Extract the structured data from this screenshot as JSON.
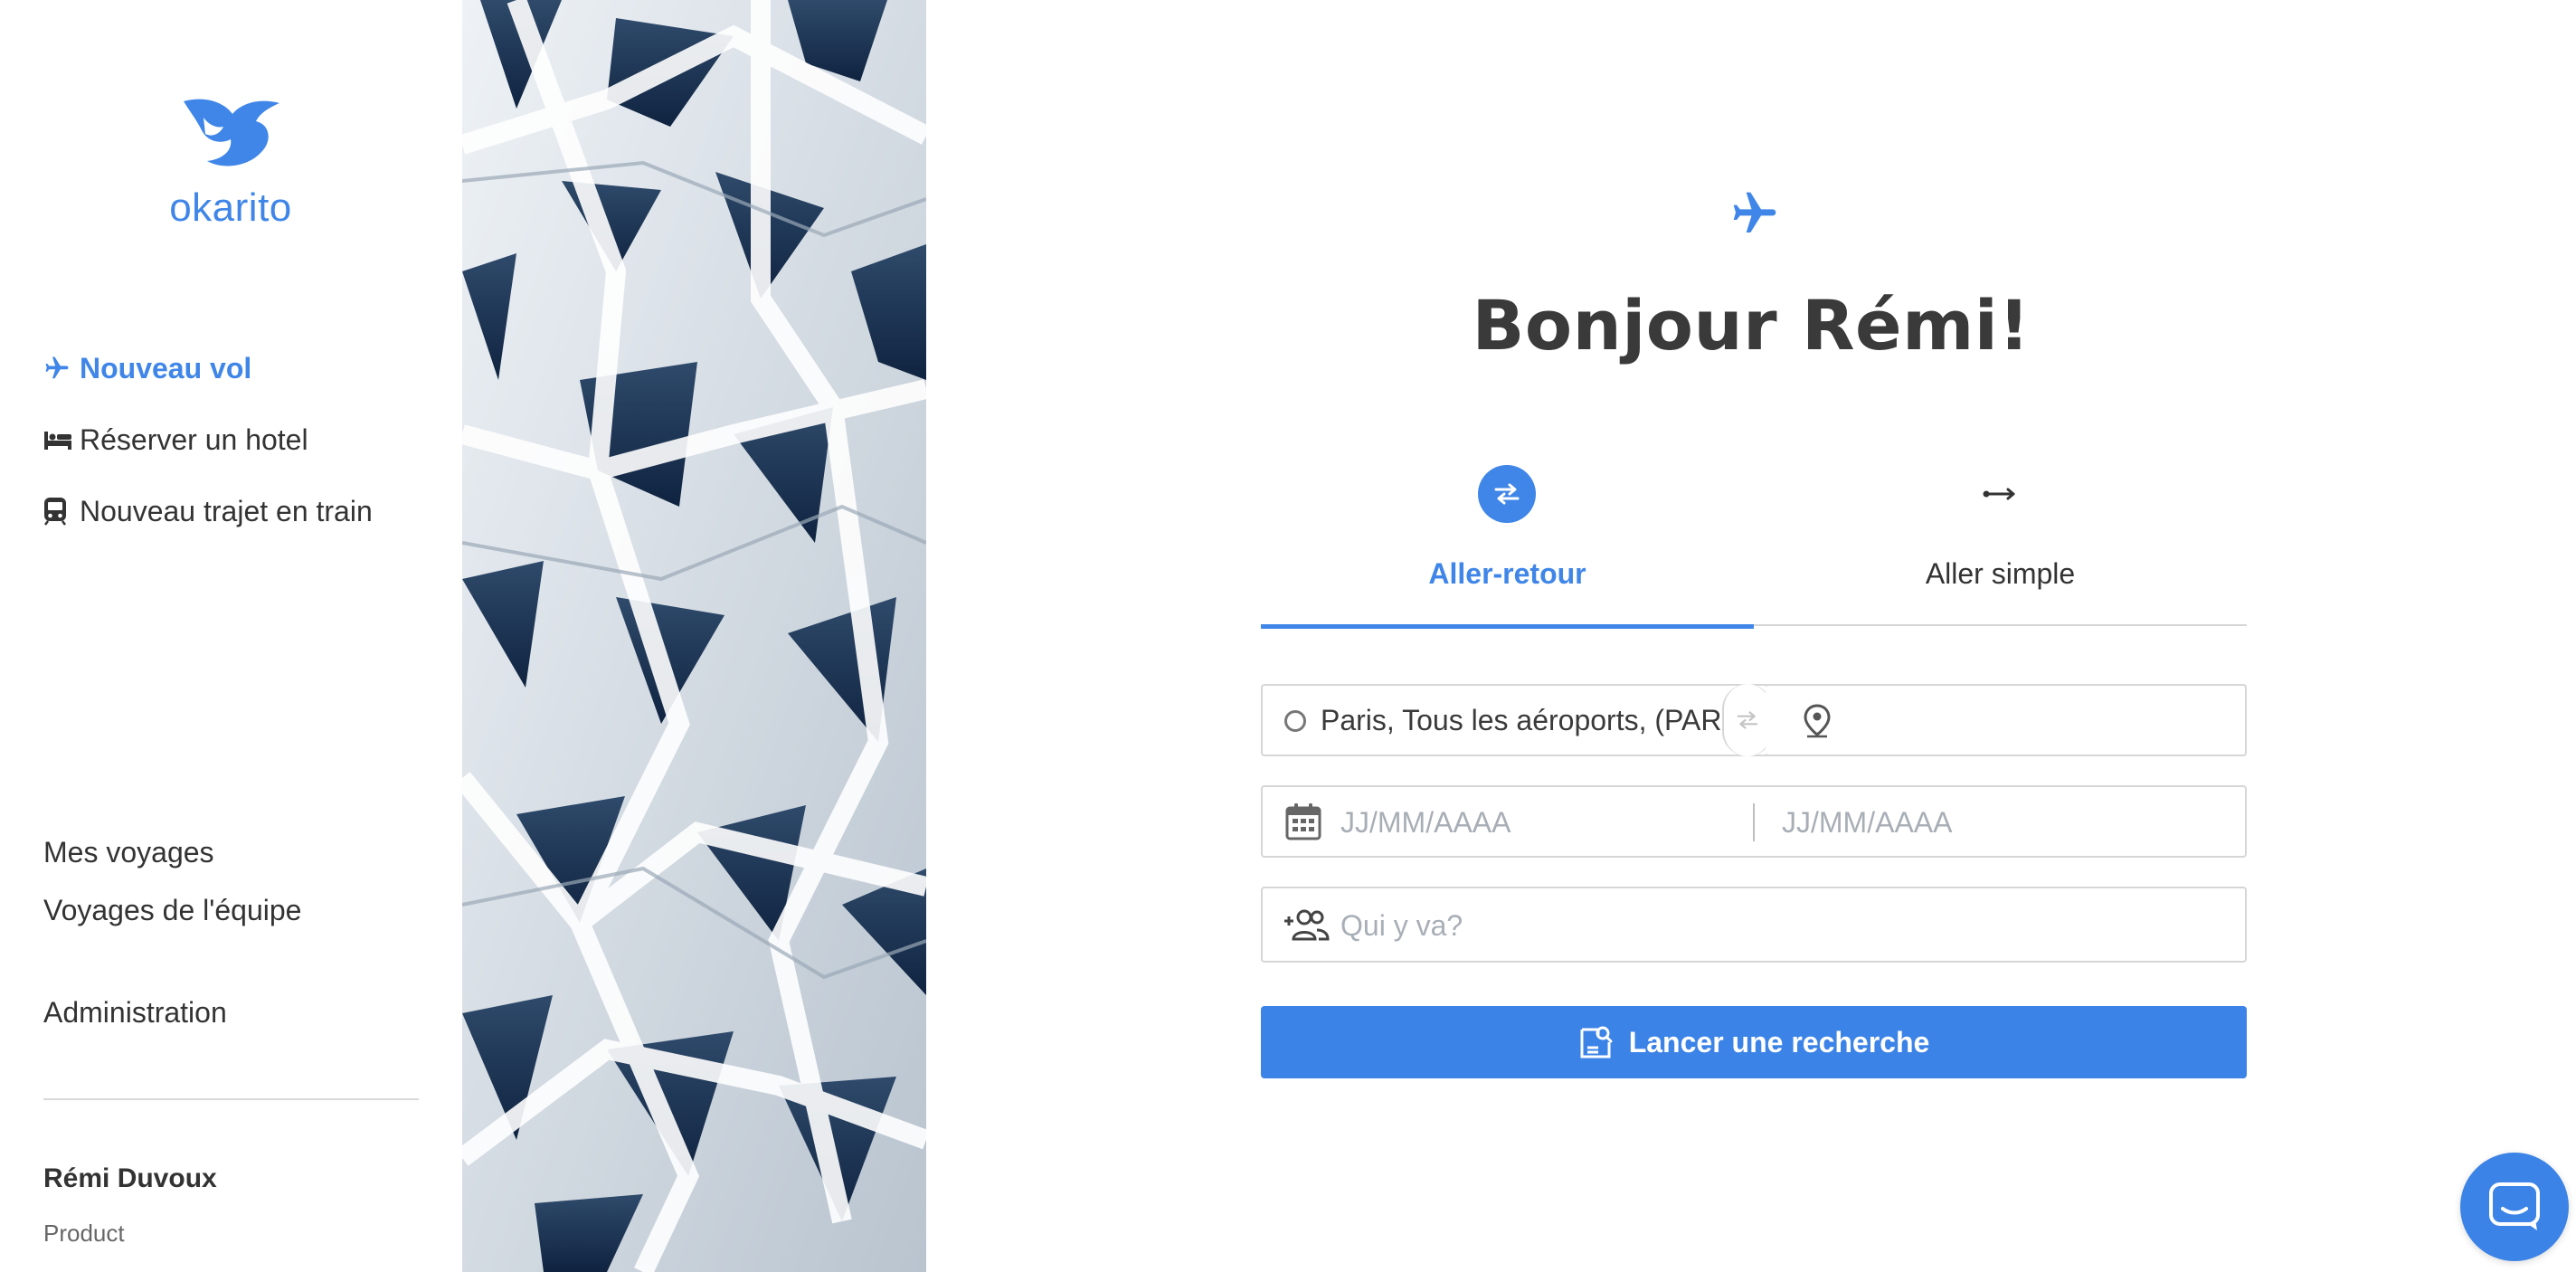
{
  "brand": {
    "name": "okarito",
    "color": "#3f86e8"
  },
  "sidebar": {
    "nav": [
      {
        "label": "Nouveau vol",
        "icon": "plane-icon",
        "active": true
      },
      {
        "label": "Réserver un hotel",
        "icon": "bed-icon",
        "active": false
      },
      {
        "label": "Nouveau trajet en train",
        "icon": "train-icon",
        "active": false
      }
    ],
    "secondary": [
      {
        "label": "Mes voyages"
      },
      {
        "label": "Voyages de l'équipe"
      },
      {
        "label": "Administration"
      }
    ],
    "user": {
      "name": "Rémi Duvoux",
      "role": "Product"
    }
  },
  "main": {
    "greeting": "Bonjour Rémi!",
    "tabs": [
      {
        "label": "Aller-retour",
        "icon": "round-trip-icon",
        "active": true
      },
      {
        "label": "Aller simple",
        "icon": "one-way-icon",
        "active": false
      }
    ],
    "origin": {
      "value": "Paris, Tous les aéroports, (PAR)"
    },
    "destination": {
      "value": "",
      "placeholder": ""
    },
    "dates": {
      "from_placeholder": "JJ/MM/AAAA",
      "to_placeholder": "JJ/MM/AAAA"
    },
    "travelers": {
      "placeholder": "Qui y va?"
    },
    "search_button": "Lancer une recherche"
  },
  "colors": {
    "accent": "#3b83e7",
    "border": "#d6d6d6",
    "placeholder": "#a8aeb6"
  }
}
